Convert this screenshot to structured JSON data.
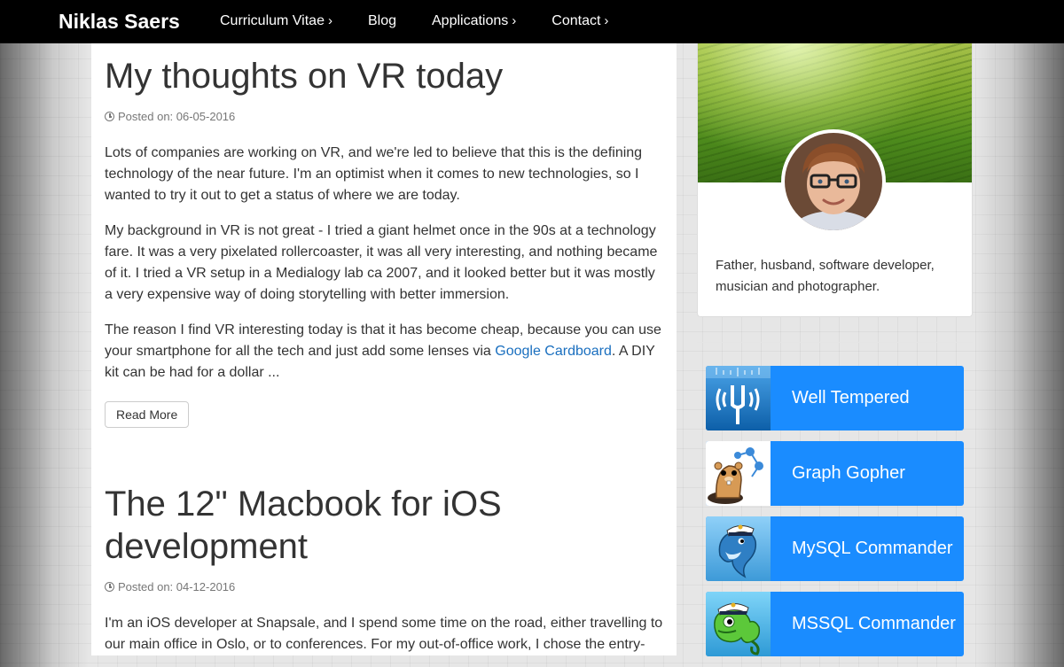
{
  "navbar": {
    "brand": "Niklas Saers",
    "items": [
      {
        "label": "Curriculum Vitae",
        "caret": "›"
      },
      {
        "label": "Blog",
        "caret": ""
      },
      {
        "label": "Applications",
        "caret": "›"
      },
      {
        "label": "Contact",
        "caret": "›"
      }
    ]
  },
  "posts": [
    {
      "title": "My thoughts on VR today",
      "meta": "Posted on: 06-05-2016",
      "p1": "Lots of companies are working on VR, and we're led to believe that this is the defining technology of the near future. I'm an optimist when it comes to new technologies, so I wanted to try it out to get a status of where we are today.",
      "p2": "My background in VR is not great - I tried a giant helmet once in the 90s at a technology fare. It was a very pixelated rollercoaster, it was all very interesting, and nothing became of it. I tried a VR setup in a Medialogy lab ca 2007, and it looked better but it was mostly a very expensive way of doing storytelling with better immersion.",
      "p3_before": "The reason I find VR interesting today is that it has become cheap, because you can use your smartphone for all the tech and just add some lenses via ",
      "p3_link": "Google Cardboard",
      "p3_after": ". A DIY kit can be had for a dollar ...",
      "read_more": "Read More"
    },
    {
      "title": "The 12\" Macbook for iOS development",
      "meta": "Posted on: 04-12-2016",
      "p1": "I'm an iOS developer at Snapsale, and I spend some time on the road, either travelling to our main office in Oslo, or to conferences. For my out-of-office work, I chose the entry-level Macbook ..."
    }
  ],
  "sidebar": {
    "bio": "Father, husband, software developer, musician and photographer.",
    "apps": [
      {
        "label": "Well Tempered",
        "icon": "tuning-fork-icon"
      },
      {
        "label": "Graph Gopher",
        "icon": "gopher-icon"
      },
      {
        "label": "MySQL Commander",
        "icon": "dolphin-icon"
      },
      {
        "label": "MSSQL Commander",
        "icon": "chameleon-icon"
      }
    ]
  },
  "colors": {
    "navbar_bg": "#000000",
    "app_tile": "#1a8cff",
    "link": "#1a6fbf"
  }
}
